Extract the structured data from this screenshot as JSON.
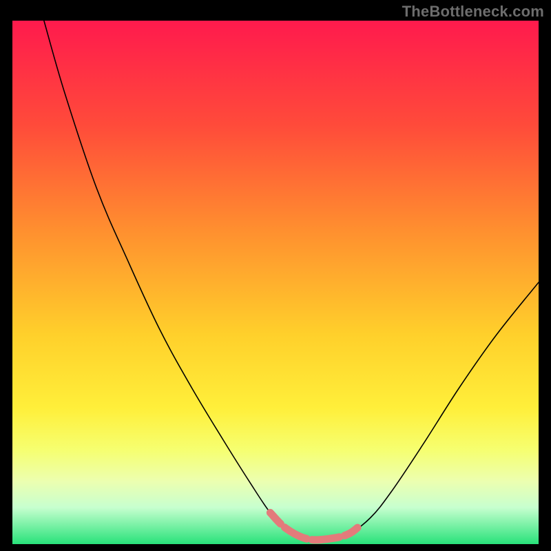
{
  "watermark": "TheBottleneck.com",
  "chart_data": {
    "type": "line",
    "title": "",
    "xlabel": "",
    "ylabel": "",
    "xlim": [
      0,
      100
    ],
    "ylim": [
      0,
      100
    ],
    "background_gradient": {
      "stops": [
        {
          "offset": 0,
          "color": "#ff1a4d"
        },
        {
          "offset": 20,
          "color": "#ff4b3a"
        },
        {
          "offset": 40,
          "color": "#ff8f2f"
        },
        {
          "offset": 60,
          "color": "#ffd02b"
        },
        {
          "offset": 74,
          "color": "#ffef3a"
        },
        {
          "offset": 82,
          "color": "#f6ff70"
        },
        {
          "offset": 88,
          "color": "#ecffb0"
        },
        {
          "offset": 93,
          "color": "#c7ffcf"
        },
        {
          "offset": 100,
          "color": "#28e27a"
        }
      ]
    },
    "series": [
      {
        "name": "bottleneck-curve",
        "color": "#000000",
        "stroke_width": 1.6,
        "points": [
          {
            "x": 6,
            "y": 100
          },
          {
            "x": 10,
            "y": 86
          },
          {
            "x": 16,
            "y": 68
          },
          {
            "x": 22,
            "y": 54
          },
          {
            "x": 28,
            "y": 41
          },
          {
            "x": 34,
            "y": 30
          },
          {
            "x": 40,
            "y": 20
          },
          {
            "x": 45,
            "y": 12
          },
          {
            "x": 49,
            "y": 6
          },
          {
            "x": 52,
            "y": 3
          },
          {
            "x": 56,
            "y": 1
          },
          {
            "x": 60,
            "y": 1
          },
          {
            "x": 64,
            "y": 2
          },
          {
            "x": 68,
            "y": 5
          },
          {
            "x": 72,
            "y": 10
          },
          {
            "x": 78,
            "y": 19
          },
          {
            "x": 85,
            "y": 30
          },
          {
            "x": 92,
            "y": 40
          },
          {
            "x": 100,
            "y": 50
          }
        ]
      },
      {
        "name": "optimal-band",
        "color": "#e37b7b",
        "stroke_width": 11,
        "points": [
          {
            "x": 49,
            "y": 6
          },
          {
            "x": 52,
            "y": 3
          },
          {
            "x": 56,
            "y": 1
          },
          {
            "x": 60,
            "y": 1
          },
          {
            "x": 64,
            "y": 2
          },
          {
            "x": 67,
            "y": 4.5
          }
        ]
      }
    ]
  }
}
